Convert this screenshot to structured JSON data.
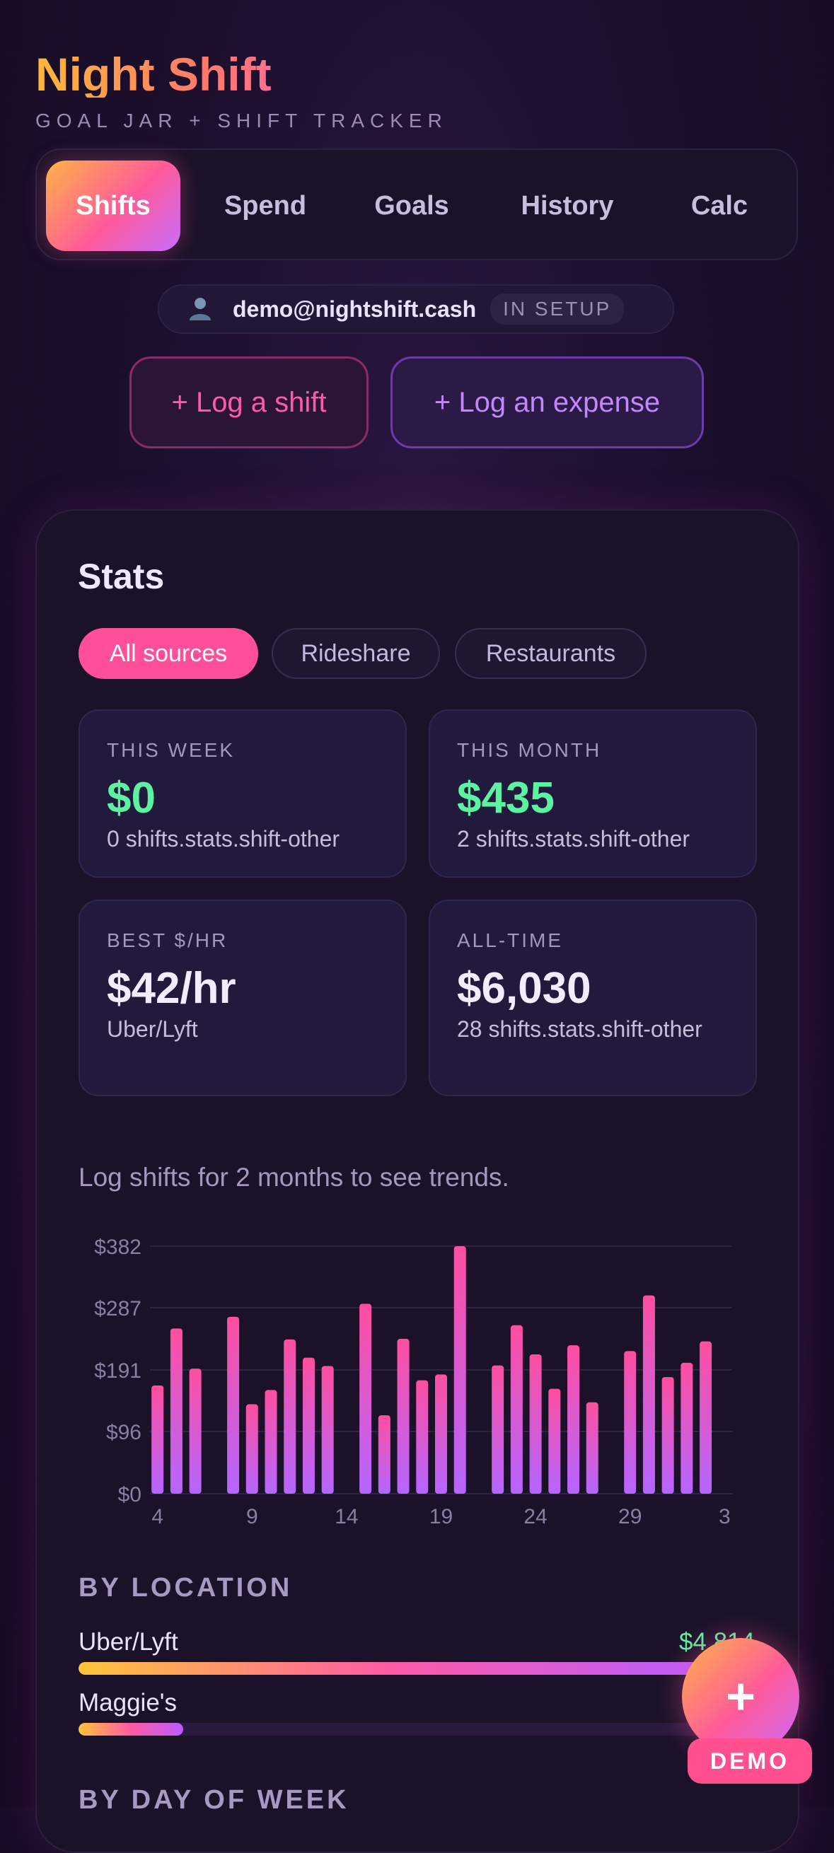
{
  "app": {
    "title": "Night Shift",
    "subtitle": "GOAL JAR + SHIFT TRACKER"
  },
  "tabs": [
    {
      "label": "Shifts",
      "active": true
    },
    {
      "label": "Spend",
      "active": false
    },
    {
      "label": "Goals",
      "active": false
    },
    {
      "label": "History",
      "active": false
    },
    {
      "label": "Calc",
      "active": false
    }
  ],
  "user": {
    "avatar_icon": "user-silhouette-icon",
    "email": "demo@nightshift.cash",
    "status": "IN SETUP"
  },
  "actions": {
    "log_shift": "+ Log a shift",
    "log_expense": "+ Log an expense"
  },
  "stats": {
    "title": "Stats",
    "filters": [
      {
        "label": "All sources",
        "selected": true
      },
      {
        "label": "Rideshare",
        "selected": false
      },
      {
        "label": "Restaurants",
        "selected": false
      }
    ],
    "cards": [
      {
        "label": "THIS WEEK",
        "value": "$0",
        "sub": "0 shifts.stats.shift-other",
        "color": "#5cf2a2"
      },
      {
        "label": "THIS MONTH",
        "value": "$435",
        "sub": "2 shifts.stats.shift-other",
        "color": "#5cf2a2"
      },
      {
        "label": "BEST $/HR",
        "value": "$42/hr",
        "sub": "Uber/Lyft",
        "color": "#f3ecff"
      },
      {
        "label": "ALL-TIME",
        "value": "$6,030",
        "sub": "28 shifts.stats.shift-other",
        "color": "#f3ecff"
      }
    ],
    "trend_message": "Log shifts for 2 months to see trends."
  },
  "chart_data": {
    "type": "bar",
    "title": "",
    "xlabel": "",
    "ylabel": "",
    "ylim": [
      0,
      382
    ],
    "y_ticks": [
      "$0",
      "$96",
      "$191",
      "$287",
      "$382"
    ],
    "y_tick_values": [
      0,
      96,
      191,
      287,
      382
    ],
    "x_tick_labels": [
      "4",
      "9",
      "14",
      "19",
      "24",
      "29",
      "3"
    ],
    "x_tick_positions": [
      4,
      9,
      14,
      19,
      24,
      29,
      34
    ],
    "x": [
      4,
      5,
      6,
      8,
      9,
      10,
      11,
      12,
      13,
      15,
      16,
      17,
      18,
      19,
      20,
      22,
      23,
      24,
      25,
      26,
      27,
      29,
      30,
      31,
      32,
      33
    ],
    "values": [
      167,
      255,
      193,
      273,
      138,
      160,
      238,
      210,
      197,
      293,
      121,
      239,
      175,
      184,
      382,
      198,
      260,
      215,
      162,
      229,
      141,
      220,
      306,
      180,
      202,
      235
    ],
    "colors": {
      "top": "#ff4fa0",
      "bottom": "#b565ff",
      "grid": "#2e2545",
      "axis_text": "#8b7ea3"
    },
    "grid": true
  },
  "by_location": {
    "heading": "BY LOCATION",
    "items": [
      {
        "name": "Uber/Lyft",
        "amount": "$4,814",
        "fraction": 0.92
      },
      {
        "name": "Maggie's",
        "amount": "$",
        "fraction": 0.155
      }
    ]
  },
  "by_day": {
    "heading": "BY DAY OF WEEK"
  },
  "fab": {
    "icon": "plus-icon",
    "label": "+"
  },
  "demo_badge": "DEMO"
}
